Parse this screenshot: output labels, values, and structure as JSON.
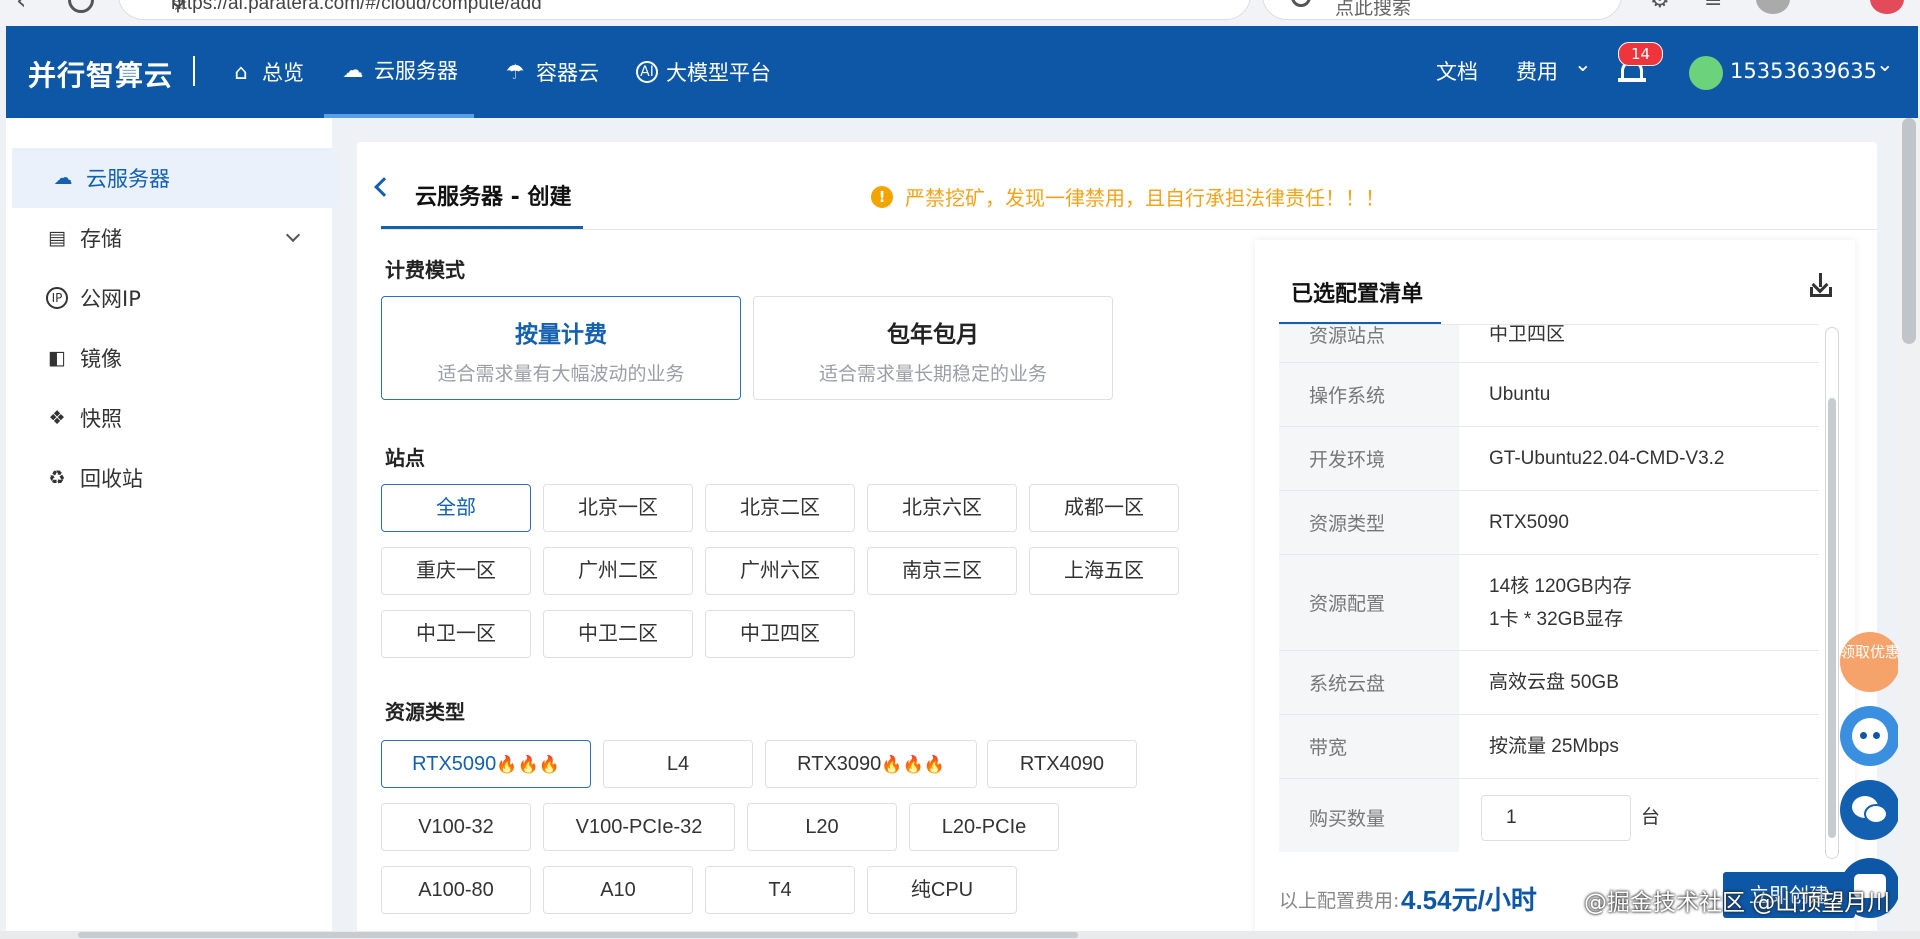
{
  "browser": {
    "url": "https://ai.paratera.com/#/cloud/compute/add",
    "search_placeholder": "点此搜索",
    "icons": [
      "back-arrow-icon",
      "reload-icon",
      "key-icon",
      "star-icon",
      "search-icon",
      "extensions-icon",
      "reading-list-icon",
      "profile-icon",
      "edge-icon"
    ]
  },
  "header": {
    "brand": "并行智算云",
    "nav": [
      {
        "label": "总览",
        "icon": "home-icon"
      },
      {
        "label": "云服务器",
        "icon": "cloud-server-icon"
      },
      {
        "label": "容器云",
        "icon": "container-cloud-icon"
      },
      {
        "label": "大模型平台",
        "icon": "ai-model-icon"
      }
    ],
    "active_nav": "云服务器",
    "docs": "文档",
    "fees": "费用",
    "notification_count": "14",
    "user": "15353639635"
  },
  "sidebar": {
    "items": [
      {
        "label": "云服务器",
        "icon": "cloud-server-icon"
      },
      {
        "label": "存储",
        "icon": "storage-icon"
      },
      {
        "label": "公网IP",
        "icon": "public-ip-icon"
      },
      {
        "label": "镜像",
        "icon": "image-icon"
      },
      {
        "label": "快照",
        "icon": "snapshot-icon"
      },
      {
        "label": "回收站",
        "icon": "recycle-bin-icon"
      }
    ]
  },
  "page": {
    "title": "云服务器 - 创建",
    "warning": "严禁挖矿，发现一律禁用，且自行承担法律责任！！！"
  },
  "billing": {
    "heading": "计费模式",
    "options": [
      {
        "title": "按量计费",
        "subtitle": "适合需求量有大幅波动的业务"
      },
      {
        "title": "包年包月",
        "subtitle": "适合需求量长期稳定的业务"
      }
    ],
    "selected": "按量计费"
  },
  "site": {
    "heading": "站点",
    "options": [
      "全部",
      "北京一区",
      "北京二区",
      "北京六区",
      "成都一区",
      "重庆一区",
      "广州二区",
      "广州六区",
      "南京三区",
      "上海五区",
      "中卫一区",
      "中卫二区",
      "中卫四区"
    ],
    "selected": "全部"
  },
  "resource": {
    "heading": "资源类型",
    "options": [
      "RTX5090",
      "L4",
      "RTX3090",
      "RTX4090",
      "V100-32",
      "V100-PCIe-32",
      "L20",
      "L20-PCIe",
      "A100-80",
      "A10",
      "T4",
      "纯CPU"
    ],
    "hot_marker": "🔥🔥🔥",
    "selected": "RTX5090"
  },
  "summary": {
    "title": "已选配置清单",
    "rows": [
      {
        "k": "资源站点",
        "v": "中卫四区"
      },
      {
        "k": "操作系统",
        "v": "Ubuntu"
      },
      {
        "k": "开发环境",
        "v": "GT-Ubuntu22.04-CMD-V3.2"
      },
      {
        "k": "资源类型",
        "v": "RTX5090"
      },
      {
        "k": "资源配置",
        "v": "14核 120GB内存",
        "v2": "1卡 * 32GB显存"
      },
      {
        "k": "系统云盘",
        "v": "高效云盘 50GB"
      },
      {
        "k": "带宽",
        "v": "按流量 25Mbps"
      },
      {
        "k": "购买数量",
        "v": "1",
        "unit": "台"
      }
    ],
    "cost_label": "以上配置费用:",
    "cost_value": "4.54元/小时",
    "create_button": "立即创建"
  },
  "float_buttons": [
    "领取优惠",
    "ai-assistant-icon",
    "wechat-icon",
    "chat-icon"
  ],
  "watermark": "@掘金技术社区 @山顶望月川",
  "colors": {
    "primary": "#0d57a6",
    "warning": "#f0a41a",
    "badge": "#f0343c"
  }
}
